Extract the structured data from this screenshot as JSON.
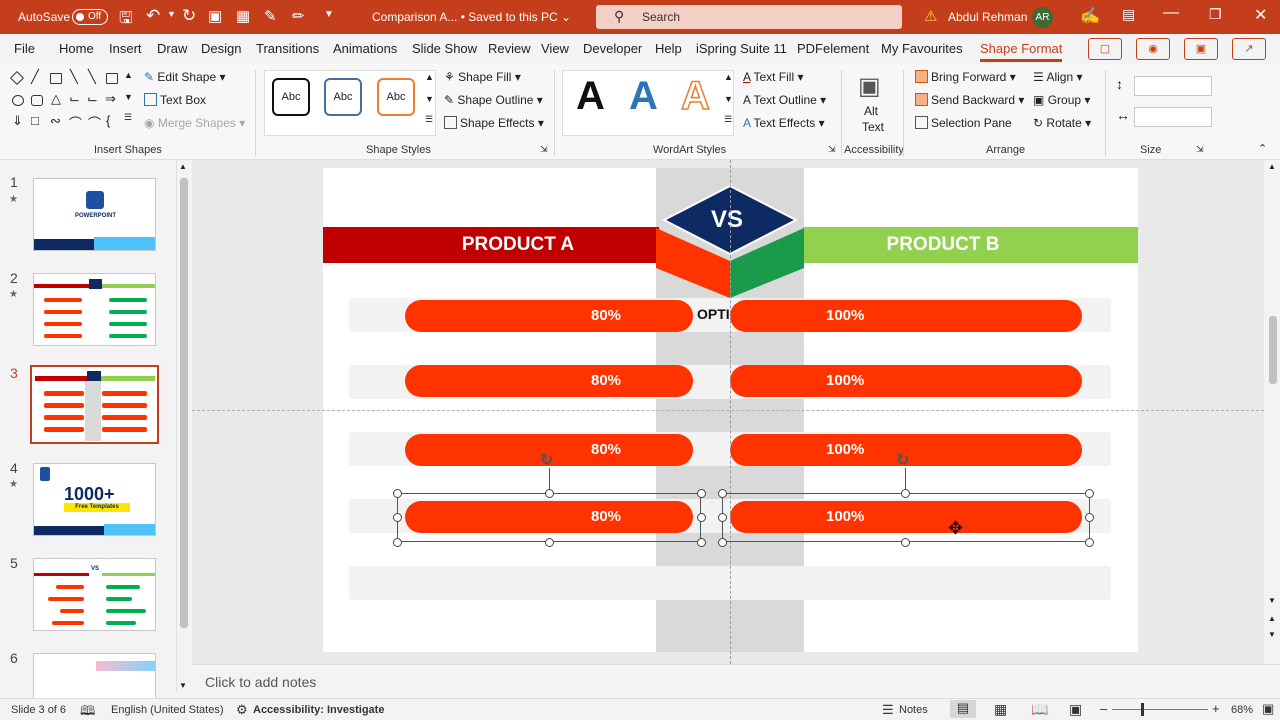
{
  "titlebar": {
    "autosave": "AutoSave",
    "toggle": "Off",
    "doc": "Comparison A...  •  Saved to this PC ⌄",
    "search": "Search",
    "user": "Abdul Rehman",
    "initials": "AR"
  },
  "tabs": [
    "File",
    "Home",
    "Insert",
    "Draw",
    "Design",
    "Transitions",
    "Animations",
    "Slide Show",
    "Review",
    "View",
    "Developer",
    "Help",
    "iSpring Suite 11",
    "PDFelement",
    "My Favourites",
    "Shape Format"
  ],
  "ribbon": {
    "insert_shapes": {
      "edit_shape": "Edit Shape",
      "text_box": "Text Box",
      "merge_shapes": "Merge Shapes",
      "label": "Insert Shapes"
    },
    "shape_styles": {
      "abc": "Abc",
      "fill": "Shape Fill",
      "outline": "Shape Outline",
      "effects": "Shape Effects",
      "label": "Shape Styles"
    },
    "wordart": {
      "sample": "A",
      "fill": "Text Fill",
      "outline": "Text Outline",
      "effects": "Text Effects",
      "label": "WordArt Styles"
    },
    "accessibility": {
      "alt": "Alt",
      "text": "Text",
      "label": "Accessibility"
    },
    "arrange": {
      "bring_forward": "Bring Forward",
      "send_backward": "Send Backward",
      "selection_pane": "Selection Pane",
      "align": "Align",
      "group": "Group",
      "rotate": "Rotate",
      "label": "Arrange"
    },
    "size": {
      "label": "Size"
    }
  },
  "thumbnails": [
    {
      "num": "1",
      "star": "★"
    },
    {
      "num": "2",
      "star": "★"
    },
    {
      "num": "3",
      "star": ""
    },
    {
      "num": "4",
      "star": "★"
    },
    {
      "num": "5",
      "star": ""
    },
    {
      "num": "6",
      "star": ""
    }
  ],
  "thumb_text": {
    "powerpoint": "POWERPOINT",
    "big": "1000+",
    "free": "Free Templates",
    "vs": "VS"
  },
  "slide": {
    "vs": "VS",
    "product_a": "PRODUCT A",
    "product_b": "PRODUCT B",
    "opti": "OPTI",
    "rows": [
      {
        "a": "80%",
        "b": "100%"
      },
      {
        "a": "80%",
        "b": "100%"
      },
      {
        "a": "80%",
        "b": "100%"
      },
      {
        "a": "80%",
        "b": "100%"
      }
    ],
    "colors": {
      "red": "#c00000",
      "orange": "#ff3300",
      "green": "#92d050",
      "navy": "#0e2a63",
      "darkgreen": "#1a9a4a"
    }
  },
  "notes": "Click to add notes",
  "status": {
    "slide": "Slide 3 of 6",
    "language": "English (United States)",
    "accessibility": "Accessibility: Investigate",
    "notes": "Notes",
    "zoom": "68%"
  }
}
